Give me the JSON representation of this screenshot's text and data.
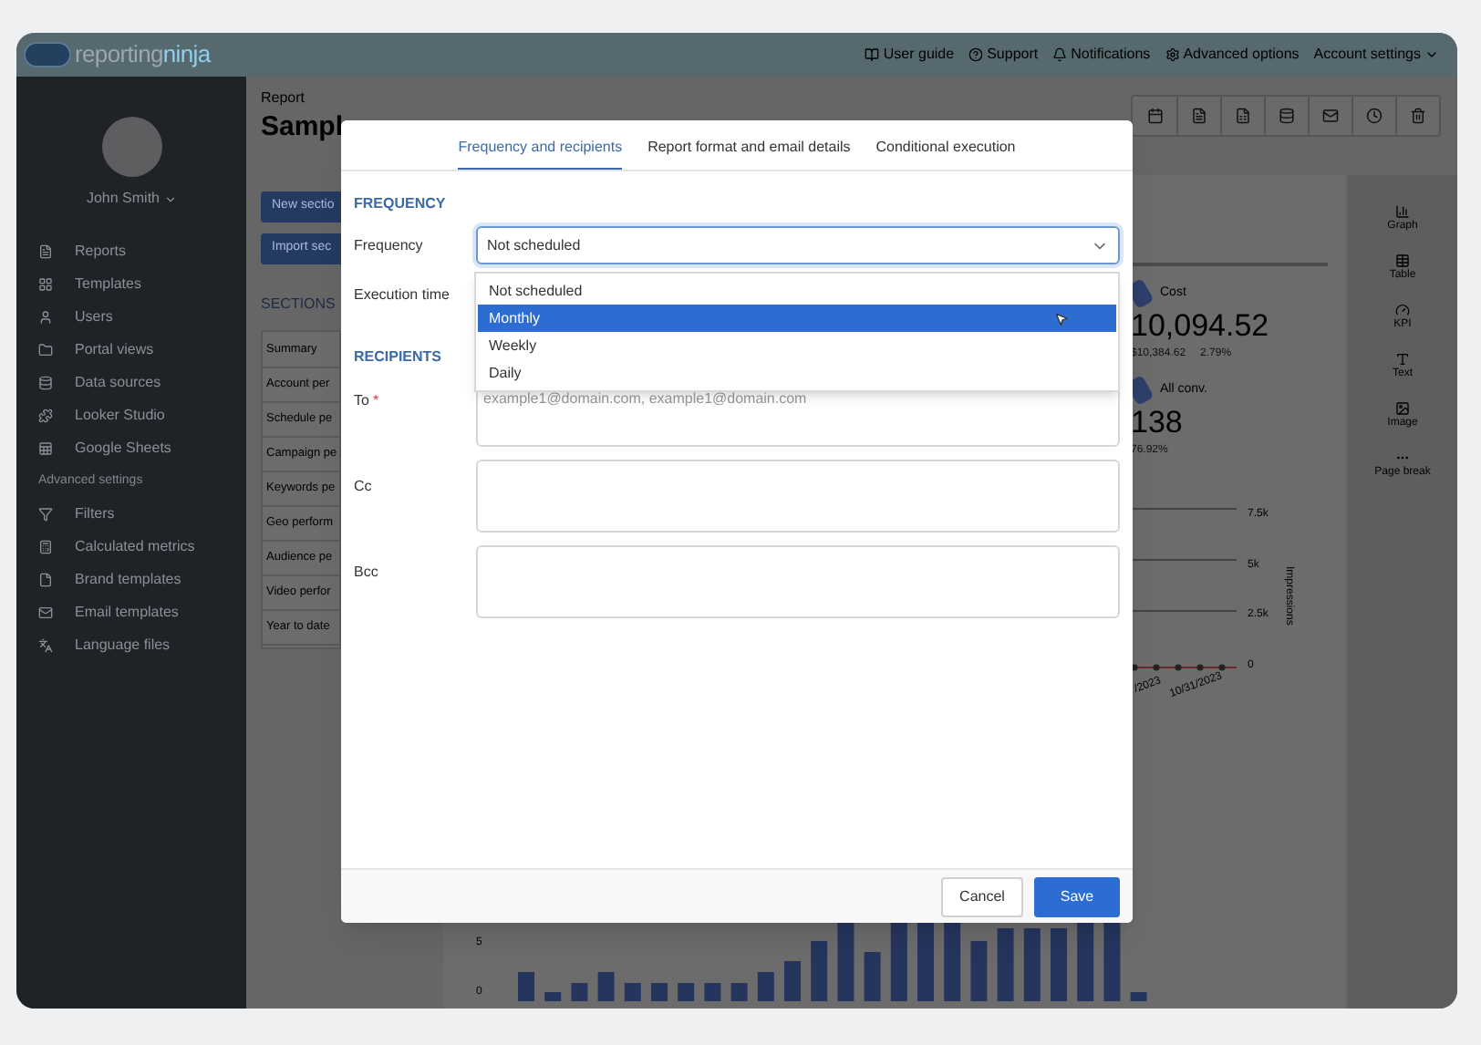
{
  "app_bar": {
    "logo": {
      "brand": "reporting",
      "accent": "ninja"
    },
    "links": [
      {
        "label": "User guide"
      },
      {
        "label": "Support"
      },
      {
        "label": "Notifications"
      },
      {
        "label": "Advanced options"
      }
    ],
    "account": "Account settings"
  },
  "sidebar": {
    "user": "John Smith",
    "items": [
      {
        "label": "Reports",
        "kind": "item"
      },
      {
        "label": "Templates",
        "kind": "item"
      },
      {
        "label": "Users",
        "kind": "item"
      },
      {
        "label": "Portal views",
        "kind": "item"
      },
      {
        "label": "Data sources",
        "kind": "item"
      },
      {
        "label": "Looker Studio",
        "kind": "item"
      },
      {
        "label": "Google Sheets",
        "kind": "item"
      },
      {
        "label": "Advanced settings",
        "kind": "heading"
      },
      {
        "label": "Filters",
        "kind": "item"
      },
      {
        "label": "Calculated metrics",
        "kind": "item"
      },
      {
        "label": "Brand templates",
        "kind": "item"
      },
      {
        "label": "Email templates",
        "kind": "item"
      },
      {
        "label": "Language files",
        "kind": "item"
      }
    ]
  },
  "page": {
    "breadcrumb": "Report",
    "title": "Sampl",
    "buttons": [
      "New sectio",
      "Import sec"
    ],
    "sections_heading": "SECTIONS",
    "sections": [
      "Summary",
      "Account per",
      "Schedule pe",
      "Campaign pe",
      "Keywords pe",
      "Geo perform",
      "Audience pe",
      "Video perfor",
      "Year to date"
    ]
  },
  "kpis": [
    {
      "label": "Cost",
      "value": "10,094.52",
      "previous": "$10,384.62",
      "change": "2.79%"
    },
    {
      "label": "All conv.",
      "value": "138",
      "change": "76.92%"
    }
  ],
  "line_chart": {
    "yticks": [
      "7.5k",
      "5k",
      "2.5k",
      "0"
    ],
    "ylabel": "Impressions",
    "xlabels": [
      "/2023",
      "10/31/2023"
    ]
  },
  "bar_chart": {
    "yticks": [
      "5",
      "0"
    ]
  },
  "widgets": [
    {
      "label": "Graph"
    },
    {
      "label": "Table"
    },
    {
      "label": "KPI"
    },
    {
      "label": "Text"
    },
    {
      "label": "Image"
    },
    {
      "label": "Page break"
    }
  ],
  "modal": {
    "tabs": [
      {
        "label": "Frequency and recipients",
        "selected": true
      },
      {
        "label": "Report format and email details",
        "selected": false
      },
      {
        "label": "Conditional execution",
        "selected": false
      }
    ],
    "frequency_heading": "FREQUENCY",
    "frequency_label": "Frequency",
    "frequency_select": {
      "value": "Not scheduled"
    },
    "dropdown": {
      "options": [
        {
          "label": "Not scheduled",
          "selected": false
        },
        {
          "label": "Monthly",
          "selected": true
        },
        {
          "label": "Weekly",
          "selected": false
        },
        {
          "label": "Daily",
          "selected": false
        }
      ]
    },
    "execution_label": "Execution time",
    "recipients_heading": "RECIPIENTS",
    "recipients": [
      {
        "label": "To",
        "required_mark": "*",
        "placeholder": "example1@domain.com, example1@domain.com"
      },
      {
        "label": "Cc"
      },
      {
        "label": "Bcc"
      }
    ],
    "buttons": {
      "cancel": "Cancel",
      "save": "Save"
    }
  }
}
